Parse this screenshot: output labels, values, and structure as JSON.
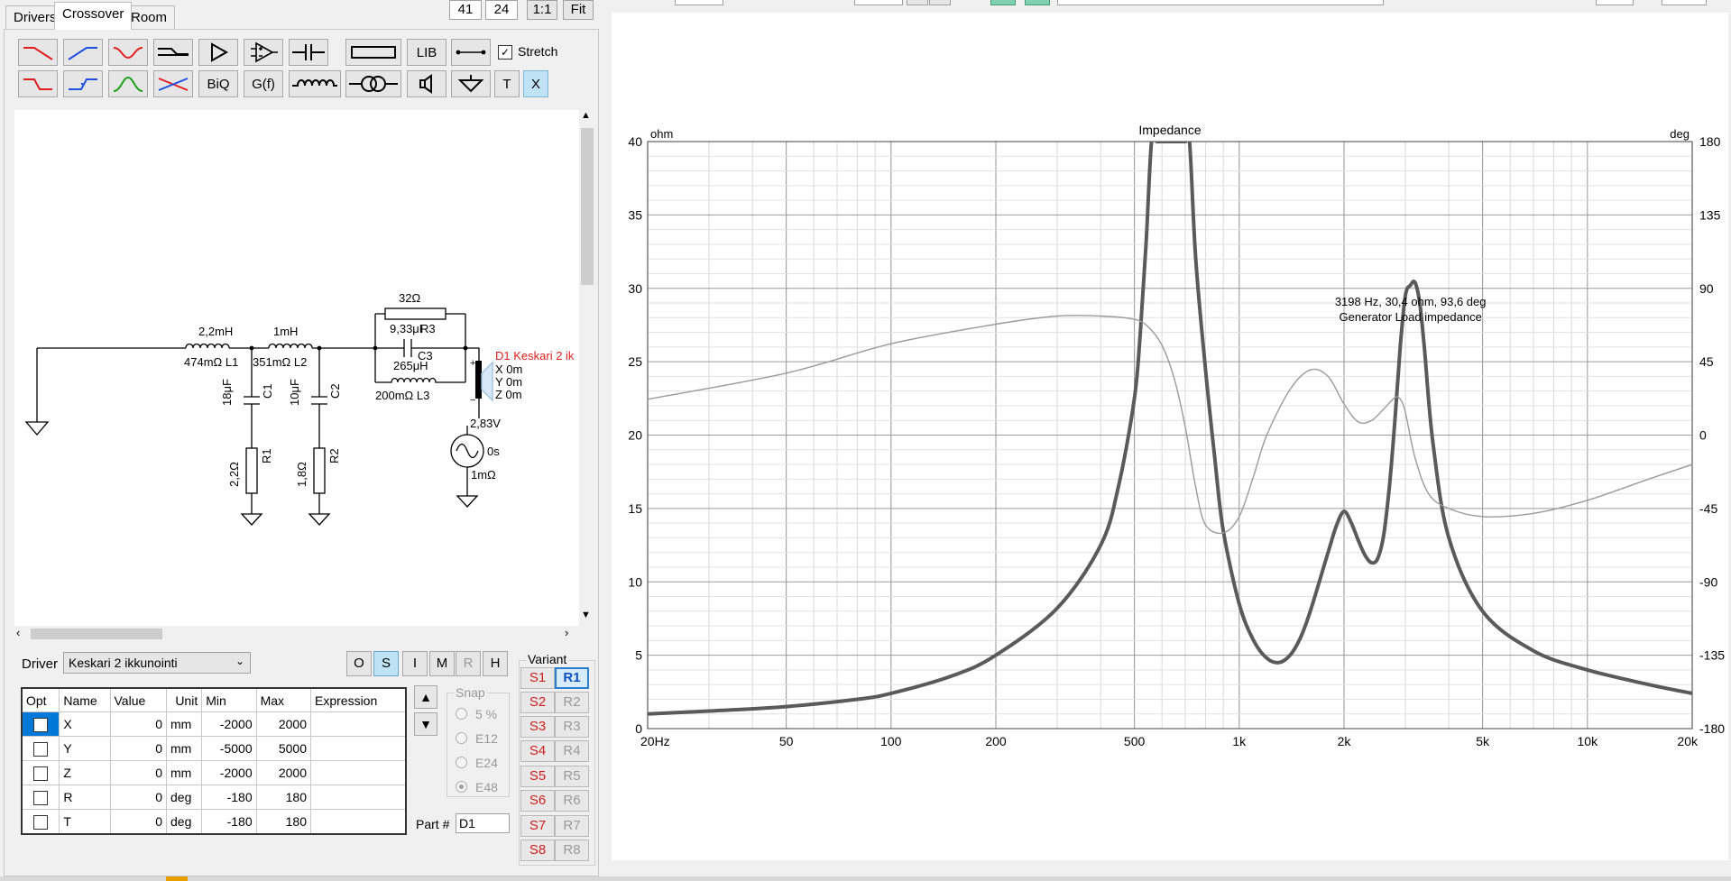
{
  "tabs": [
    {
      "label": "Drivers"
    },
    {
      "label": "Crossover"
    },
    {
      "label": "Room"
    }
  ],
  "top_controls": {
    "v1": "41",
    "v2": "24",
    "ratio": "1:1",
    "fit": "Fit"
  },
  "toolbar": {
    "lib": "LIB",
    "stretch": "Stretch",
    "biq": "BiQ",
    "gf": "G(f)",
    "t": "T",
    "x": "X"
  },
  "schematic": {
    "l1_val": "2,2mH",
    "l1_name": "474mΩ L1",
    "l2_val": "1mH",
    "l2_name": "351mΩ L2",
    "c1_val": "18μF",
    "c1_name": "C1",
    "r1_val": "2,2Ω",
    "r1_name": "R1",
    "c2_val": "10μF",
    "c2_name": "C2",
    "r2_val": "1,8Ω",
    "r2_name": "R2",
    "r3_val": "32Ω",
    "c3_val": "9,33μF",
    "r3_name": "R3",
    "c3_name": "C3",
    "l3_val": "265μH",
    "l3_name": "200mΩ L3",
    "driver_name": "D1 Keskari 2 ik",
    "dx": "X 0m",
    "dy": "Y 0m",
    "dz": "Z 0m",
    "gen_v": "2,83V",
    "gen_t": "0s",
    "gen_r": "1mΩ"
  },
  "driver_bar": {
    "label": "Driver",
    "selected": "Keskari 2 ikkunointi",
    "modes": [
      {
        "label": "O"
      },
      {
        "label": "S"
      },
      {
        "label": "I"
      },
      {
        "label": "M"
      },
      {
        "label": "R"
      },
      {
        "label": "H"
      }
    ]
  },
  "params": {
    "headers": [
      "Opt",
      "Name",
      "Value",
      "Unit",
      "Min",
      "Max",
      "Expression"
    ],
    "rows": [
      {
        "name": "X",
        "value": "0",
        "unit": "mm",
        "min": "-2000",
        "max": "2000",
        "expr": ""
      },
      {
        "name": "Y",
        "value": "0",
        "unit": "mm",
        "min": "-5000",
        "max": "5000",
        "expr": ""
      },
      {
        "name": "Z",
        "value": "0",
        "unit": "mm",
        "min": "-2000",
        "max": "2000",
        "expr": ""
      },
      {
        "name": "R",
        "value": "0",
        "unit": "deg",
        "min": "-180",
        "max": "180",
        "expr": ""
      },
      {
        "name": "T",
        "value": "0",
        "unit": "deg",
        "min": "-180",
        "max": "180",
        "expr": ""
      }
    ]
  },
  "snap": {
    "label": "Snap",
    "options": [
      "5 %",
      "E12",
      "E24",
      "E48"
    ],
    "selected": "E48"
  },
  "part": {
    "label": "Part #",
    "value": "D1"
  },
  "variant": {
    "label": "Variant",
    "s": [
      "S1",
      "S2",
      "S3",
      "S4",
      "S5",
      "S6",
      "S7",
      "S8"
    ],
    "r": [
      "R1",
      "R2",
      "R3",
      "R4",
      "R5",
      "R6",
      "R7",
      "R8"
    ]
  },
  "chart_data": {
    "type": "line",
    "title": "Impedance",
    "ylabel": "ohm",
    "y2label": "deg",
    "x_scale": "log",
    "xlim": [
      20,
      20000
    ],
    "ylim": [
      0,
      40
    ],
    "y2lim": [
      -180,
      180
    ],
    "x_ticks": [
      {
        "v": 20,
        "label": "20Hz"
      },
      {
        "v": 50,
        "label": "50"
      },
      {
        "v": 100,
        "label": "100"
      },
      {
        "v": 200,
        "label": "200"
      },
      {
        "v": 500,
        "label": "500"
      },
      {
        "v": 1000,
        "label": "1k"
      },
      {
        "v": 2000,
        "label": "2k"
      },
      {
        "v": 5000,
        "label": "5k"
      },
      {
        "v": 10000,
        "label": "10k"
      },
      {
        "v": 20000,
        "label": "20k"
      }
    ],
    "y_ticks": [
      "0",
      "5",
      "10",
      "15",
      "20",
      "25",
      "30",
      "35",
      "40"
    ],
    "y2_ticks": [
      "-180",
      "-135",
      "-90",
      "-45",
      "0",
      "45",
      "90",
      "135",
      "180"
    ],
    "grid": true,
    "series": [
      {
        "axis": "left",
        "color": "#5a5a5a",
        "x": [
          20,
          30,
          50,
          80,
          100,
          150,
          200,
          300,
          400,
          450,
          500,
          520,
          540,
          560,
          580,
          600,
          640,
          700,
          720,
          750,
          800,
          850,
          900,
          1000,
          1100,
          1200,
          1300,
          1400,
          1500,
          1600,
          1800,
          1900,
          2000,
          2100,
          2200,
          2300,
          2400,
          2500,
          2600,
          2700,
          2800,
          2900,
          3000,
          3100,
          3198,
          3300,
          3400,
          3600,
          4000,
          5000,
          7000,
          10000,
          15000,
          20000
        ],
        "y": [
          1.0,
          1.2,
          1.5,
          2.0,
          2.4,
          3.6,
          5.0,
          8.2,
          12.5,
          16.5,
          22.5,
          27,
          33,
          40,
          40,
          40,
          40,
          40,
          40,
          32,
          24.5,
          18.5,
          13.5,
          8.5,
          6.0,
          4.8,
          4.5,
          5.0,
          6.2,
          8.0,
          12.0,
          13.8,
          14.8,
          14.0,
          12.8,
          11.8,
          11.3,
          11.6,
          13.2,
          16.5,
          21.0,
          26.0,
          29.5,
          30.2,
          30.4,
          29.0,
          26.0,
          19.5,
          13.0,
          8.0,
          5.3,
          4.0,
          3.0,
          2.4
        ]
      },
      {
        "axis": "right",
        "color": "#9a9a9a",
        "x": [
          20,
          50,
          100,
          200,
          300,
          400,
          500,
          550,
          600,
          650,
          700,
          750,
          800,
          900,
          1000,
          1100,
          1200,
          1400,
          1600,
          1800,
          2000,
          2200,
          2400,
          2600,
          2800,
          2900,
          3000,
          3200,
          3500,
          4000,
          5000,
          7000,
          10000,
          15000,
          20000
        ],
        "y": [
          22,
          38,
          56,
          68,
          73,
          73,
          71,
          66,
          55,
          35,
          5,
          -32,
          -55,
          -60,
          -50,
          -25,
          0,
          28,
          40,
          36,
          19,
          8,
          9,
          16,
          23,
          22,
          14,
          -14,
          -36,
          -45,
          -50,
          -48,
          -40,
          -27,
          -18
        ]
      }
    ],
    "annotation": [
      "3198 Hz, 30,4 ohm, 93,6 deg",
      "Generator Load impedance"
    ]
  }
}
